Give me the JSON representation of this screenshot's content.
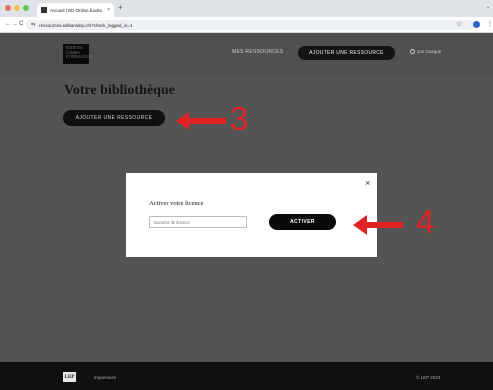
{
  "browser": {
    "tab_title": "Accueil | ED Online books",
    "tab_close": "×",
    "new_tab": "+",
    "tab_chevron": "⌄",
    "back": "←",
    "forward": "→",
    "reload": "C",
    "site_icon": "⇆",
    "url": "ressources.editionslep.ch/?check_logged_in=1",
    "star": "☆",
    "menu": "⋮"
  },
  "header": {
    "logo_lines": [
      "ÉDITIONS",
      "LOISIRS",
      "ET PÉDAGOGIE"
    ],
    "mes_ressources": "MES RESSOURCES",
    "ajouter_ressource": "AJOUTER UNE RESSOURCE",
    "user_name": "Jon Gasque"
  },
  "main": {
    "title": "Votre bibliothèque",
    "add_button": "AJOUTER UNE RESSOURCE"
  },
  "annotations": {
    "step3": "3",
    "step4": "4"
  },
  "modal": {
    "close": "×",
    "title": "Activer votre licence",
    "licence_placeholder": "Numéro de licence",
    "activate_button": "ACTIVER"
  },
  "footer": {
    "logo": "LEP",
    "impressum": "Impressum",
    "copyright": "© LEP 2023"
  },
  "colors": {
    "overlay_bg": "#545454",
    "annotation_red": "#e02222",
    "button_black": "#0a0a0a"
  },
  "icons": [
    "close-icon",
    "back-arrow-icon",
    "forward-arrow-icon",
    "reload-icon",
    "site-settings-icon",
    "star-icon",
    "user-icon",
    "arrow-left-icon"
  ]
}
